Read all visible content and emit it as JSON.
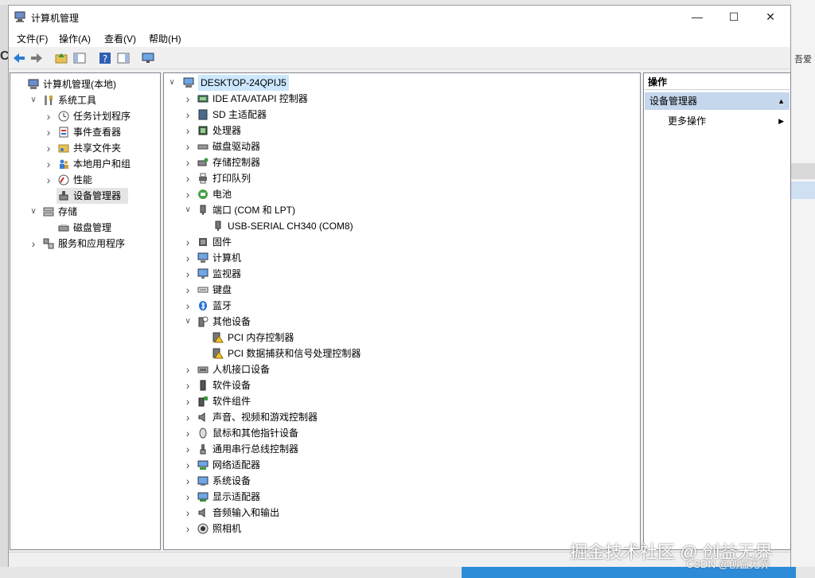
{
  "window": {
    "title": "计算机管理"
  },
  "menu": [
    "文件(F)",
    "操作(A)",
    "查看(V)",
    "帮助(H)"
  ],
  "left_tree": [
    {
      "label": "计算机管理(本地)",
      "level": 0,
      "toggle": "",
      "icon": "computer-management-icon"
    },
    {
      "label": "系统工具",
      "level": 1,
      "toggle": "expanded",
      "icon": "tools-icon"
    },
    {
      "label": "任务计划程序",
      "level": 2,
      "toggle": "collapsed",
      "icon": "clock-icon"
    },
    {
      "label": "事件查看器",
      "level": 2,
      "toggle": "collapsed",
      "icon": "event-viewer-icon"
    },
    {
      "label": "共享文件夹",
      "level": 2,
      "toggle": "collapsed",
      "icon": "shared-folder-icon"
    },
    {
      "label": "本地用户和组",
      "level": 2,
      "toggle": "collapsed",
      "icon": "users-icon"
    },
    {
      "label": "性能",
      "level": 2,
      "toggle": "collapsed",
      "icon": "performance-icon"
    },
    {
      "label": "设备管理器",
      "level": 2,
      "toggle": "",
      "icon": "device-manager-icon",
      "selected": true
    },
    {
      "label": "存储",
      "level": 1,
      "toggle": "expanded",
      "icon": "storage-icon"
    },
    {
      "label": "磁盘管理",
      "level": 2,
      "toggle": "",
      "icon": "disk-management-icon"
    },
    {
      "label": "服务和应用程序",
      "level": 1,
      "toggle": "collapsed",
      "icon": "services-icon"
    }
  ],
  "device_tree": {
    "root": "DESKTOP-24QPIJ5",
    "items": [
      {
        "label": "IDE ATA/ATAPI 控制器",
        "level": 1,
        "toggle": "collapsed",
        "icon": "ide-icon"
      },
      {
        "label": "SD 主适配器",
        "level": 1,
        "toggle": "collapsed",
        "icon": "sd-icon"
      },
      {
        "label": "处理器",
        "level": 1,
        "toggle": "collapsed",
        "icon": "processor-icon"
      },
      {
        "label": "磁盘驱动器",
        "level": 1,
        "toggle": "collapsed",
        "icon": "disk-drive-icon"
      },
      {
        "label": "存储控制器",
        "level": 1,
        "toggle": "collapsed",
        "icon": "storage-controller-icon"
      },
      {
        "label": "打印队列",
        "level": 1,
        "toggle": "collapsed",
        "icon": "printer-icon"
      },
      {
        "label": "电池",
        "level": 1,
        "toggle": "collapsed",
        "icon": "battery-icon"
      },
      {
        "label": "端口 (COM 和 LPT)",
        "level": 1,
        "toggle": "expanded",
        "icon": "port-icon"
      },
      {
        "label": "USB-SERIAL CH340 (COM8)",
        "level": 2,
        "toggle": "",
        "icon": "port-icon"
      },
      {
        "label": "固件",
        "level": 1,
        "toggle": "collapsed",
        "icon": "firmware-icon"
      },
      {
        "label": "计算机",
        "level": 1,
        "toggle": "collapsed",
        "icon": "computer-icon"
      },
      {
        "label": "监视器",
        "level": 1,
        "toggle": "collapsed",
        "icon": "monitor-icon"
      },
      {
        "label": "键盘",
        "level": 1,
        "toggle": "collapsed",
        "icon": "keyboard-icon"
      },
      {
        "label": "蓝牙",
        "level": 1,
        "toggle": "collapsed",
        "icon": "bluetooth-icon"
      },
      {
        "label": "其他设备",
        "level": 1,
        "toggle": "expanded",
        "icon": "other-devices-icon"
      },
      {
        "label": "PCI 内存控制器",
        "level": 2,
        "toggle": "",
        "icon": "warning-icon"
      },
      {
        "label": "PCI 数据捕获和信号处理控制器",
        "level": 2,
        "toggle": "",
        "icon": "warning-icon"
      },
      {
        "label": "人机接口设备",
        "level": 1,
        "toggle": "collapsed",
        "icon": "hid-icon"
      },
      {
        "label": "软件设备",
        "level": 1,
        "toggle": "collapsed",
        "icon": "software-device-icon"
      },
      {
        "label": "软件组件",
        "level": 1,
        "toggle": "collapsed",
        "icon": "software-component-icon"
      },
      {
        "label": "声音、视频和游戏控制器",
        "level": 1,
        "toggle": "collapsed",
        "icon": "sound-icon"
      },
      {
        "label": "鼠标和其他指针设备",
        "level": 1,
        "toggle": "collapsed",
        "icon": "mouse-icon"
      },
      {
        "label": "通用串行总线控制器",
        "level": 1,
        "toggle": "collapsed",
        "icon": "usb-icon"
      },
      {
        "label": "网络适配器",
        "level": 1,
        "toggle": "collapsed",
        "icon": "network-icon"
      },
      {
        "label": "系统设备",
        "level": 1,
        "toggle": "collapsed",
        "icon": "system-device-icon"
      },
      {
        "label": "显示适配器",
        "level": 1,
        "toggle": "collapsed",
        "icon": "display-adapter-icon"
      },
      {
        "label": "音频输入和输出",
        "level": 1,
        "toggle": "collapsed",
        "icon": "audio-icon"
      },
      {
        "label": "照相机",
        "level": 1,
        "toggle": "collapsed",
        "icon": "camera-icon"
      }
    ]
  },
  "actions": {
    "header": "操作",
    "section": "设备管理器",
    "more": "更多操作"
  },
  "background": {
    "right_text": "吾爱",
    "watermark": "掘金技术社区 @ 创益无界",
    "watermark2": "CSDN @创益无界"
  },
  "colors": {
    "selection": "#e5e5e5",
    "actions_section": "#c4d7ec",
    "root_highlight": "#cce8ff"
  }
}
